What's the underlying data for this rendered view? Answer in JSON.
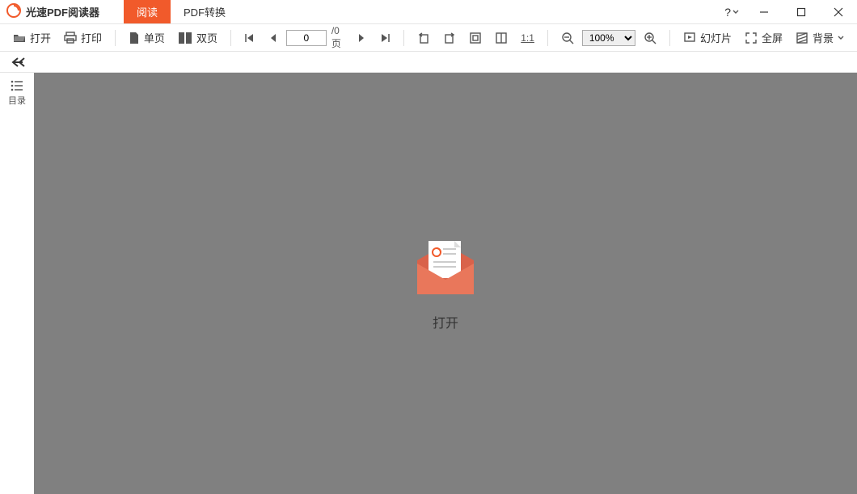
{
  "app": {
    "title": "光速PDF阅读器"
  },
  "tabs": {
    "read": "阅读",
    "convert": "PDF转换"
  },
  "toolbar": {
    "open": "打开",
    "print": "打印",
    "single_page": "单页",
    "double_page": "双页",
    "page_value": "0",
    "page_total": "/0页",
    "zoom_value": "100%",
    "slideshow": "幻灯片",
    "fullscreen": "全屏",
    "background": "背景"
  },
  "sidebar": {
    "toc": "目录"
  },
  "canvas": {
    "open_label": "打开"
  },
  "help": {
    "label": "?"
  }
}
